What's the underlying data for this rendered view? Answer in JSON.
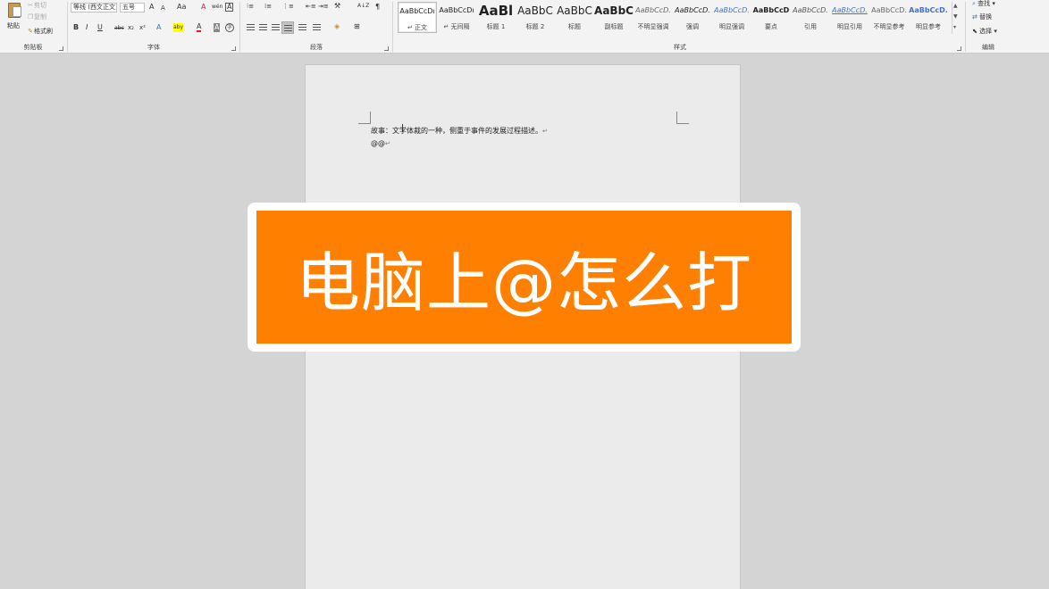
{
  "clipboard": {
    "paste": "粘贴",
    "cut": "剪切",
    "copy": "复制",
    "format_painter": "格式刷",
    "group_label": "剪贴板"
  },
  "font": {
    "font_name": "等线 (西文正文)",
    "font_size": "五号",
    "grow": "A",
    "shrink": "A",
    "case": "Aa",
    "clear": "A",
    "phonetic": "wén",
    "border_char": "A",
    "bold": "B",
    "italic": "I",
    "underline": "U",
    "strikethrough": "abc",
    "subscript": "x₂",
    "superscript": "x²",
    "text_effect": "A",
    "highlight": "aby",
    "font_color": "A",
    "shade": "A",
    "enclose": "字",
    "group_label": "字体"
  },
  "paragraph": {
    "group_label": "段落",
    "sort": "A↓Z",
    "show_marks": "¶"
  },
  "styles": {
    "group_label": "样式",
    "items": [
      {
        "sample": "AaBbCcDı",
        "name": "↵ 正文"
      },
      {
        "sample": "AaBbCcDı",
        "name": "↵ 无间隔"
      },
      {
        "sample": "AaBl",
        "name": "标题 1"
      },
      {
        "sample": "AaBbC",
        "name": "标题 2"
      },
      {
        "sample": "AaBbC",
        "name": "标题"
      },
      {
        "sample": "AaBbC",
        "name": "副标题"
      },
      {
        "sample": "AaBbCcD.",
        "name": "不明显强调"
      },
      {
        "sample": "AaBbCcD.",
        "name": "强调"
      },
      {
        "sample": "AaBbCcD.",
        "name": "明显强调"
      },
      {
        "sample": "AaBbCcD",
        "name": "要点"
      },
      {
        "sample": "AaBbCcD.",
        "name": "引用"
      },
      {
        "sample": "AaBbCcD.",
        "name": "明显引用"
      },
      {
        "sample": "AaBbCcD.",
        "name": "不明显参考"
      },
      {
        "sample": "AaBbCcD.",
        "name": "明显参考"
      }
    ]
  },
  "editing": {
    "find": "查找",
    "replace": "替换",
    "select": "选择",
    "group_label": "编辑"
  },
  "document": {
    "line1": "故事：文学体裁的一种，侧重于事件的发展过程描述。",
    "line2": "@@"
  },
  "banner": {
    "text": "电脑上@怎么打"
  },
  "colors": {
    "banner_orange": "#ff7f00",
    "page_background": "#ebebeb",
    "workspace_background": "#d4d4d4"
  }
}
